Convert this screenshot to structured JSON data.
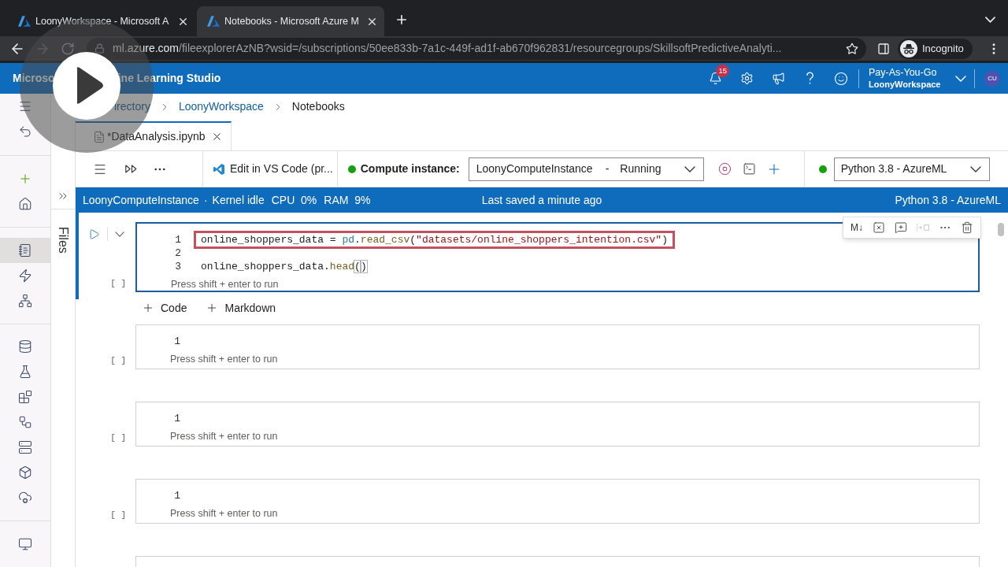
{
  "browser": {
    "tabs": [
      {
        "title": "LoonyWorkspace - Microsoft A",
        "selected": false
      },
      {
        "title": "Notebooks - Microsoft Azure M",
        "selected": true
      }
    ],
    "back": {
      "disabled": false
    },
    "forward": {
      "disabled": true
    },
    "address": {
      "host": "ml.azure.com",
      "path": "/fileexplorerAzNB?wsid=/subscriptions/50ee833b-7a1c-449f-ad1f-ab670f962831/resourcegroups/SkillsoftPredictiveAnalyti..."
    },
    "profile": "Incognito"
  },
  "studio_header": {
    "title_start": "Microso",
    "title_end": "ine Learning Studio",
    "notification_count": "15",
    "subscription": "Pay-As-You-Go",
    "workspace": "LoonyWorkspace",
    "avatar_initials": "CU"
  },
  "nav": {
    "groups": [
      {
        "items": [
          {
            "selected": false
          },
          {
            "selected": false
          }
        ]
      },
      {
        "items": [
          {
            "selected": false
          },
          {
            "selected": false
          }
        ]
      },
      {
        "items": [
          {
            "selected": true
          },
          {
            "selected": false
          },
          {
            "selected": false
          }
        ]
      },
      {
        "items": [
          {
            "selected": false
          },
          {
            "selected": false
          },
          {
            "selected": false
          },
          {
            "selected": false
          },
          {
            "selected": false
          },
          {
            "selected": false
          },
          {
            "selected": false
          }
        ]
      },
      {
        "items": [
          {
            "selected": false
          }
        ]
      }
    ]
  },
  "breadcrumb": [
    {
      "label": "irectory",
      "current": false
    },
    {
      "label": "LoonyWorkspace",
      "current": false
    },
    {
      "label": "Notebooks",
      "current": true
    }
  ],
  "files_panel": {
    "label": "Files"
  },
  "file_tabs": [
    {
      "title": "*DataAnalysis.ipynb",
      "selected": true
    }
  ],
  "toolbar": {
    "vscode": "Edit in VS Code (pr...",
    "compute_label": "Compute instance:",
    "compute_running": true,
    "compute": {
      "name": "LoonyComputeInstance",
      "separator": "-",
      "state": "Running"
    },
    "kernel_connected": true,
    "kernel": "Python 3.8 - AzureML"
  },
  "status_bar": {
    "compute": "LoonyComputeInstance",
    "separator": "·",
    "kernel_state": "Kernel idle",
    "metrics": [
      {
        "label": "CPU",
        "value": "0%"
      },
      {
        "label": "RAM",
        "value": "9%"
      }
    ],
    "saved": "Last saved a minute ago",
    "kernel": "Python 3.8 - AzureML"
  },
  "cell_toolbar": {
    "markdown": "M↓",
    "actions": [
      {
        "disabled": false
      },
      {
        "disabled": false
      },
      {
        "disabled": true
      },
      {
        "disabled": false
      },
      {
        "disabled": false
      }
    ]
  },
  "cells": [
    {
      "selected": true,
      "prompt": "[ ]",
      "lines": [
        {
          "number": "1",
          "marked": true,
          "tokens": [
            {
              "kind": "name",
              "text": "online_shoppers_data = "
            },
            {
              "kind": "module",
              "text": "pd"
            },
            {
              "kind": "plain",
              "text": "."
            },
            {
              "kind": "function",
              "text": "read_csv"
            },
            {
              "kind": "plain",
              "text": "("
            },
            {
              "kind": "string",
              "text": "\"datasets/online_shoppers_intention.csv\""
            },
            {
              "kind": "plain",
              "text": ")"
            }
          ]
        },
        {
          "number": "2",
          "marked": false
        },
        {
          "number": "3",
          "marked": false,
          "tokens": [
            {
              "kind": "name",
              "text": "online_shoppers_data"
            },
            {
              "kind": "plain",
              "text": "."
            },
            {
              "kind": "function",
              "text": "head"
            },
            {
              "kind": "bracket",
              "text": "("
            },
            {
              "kind": "bracket",
              "text": ")"
            }
          ]
        }
      ],
      "hint": "Press shift + enter to run"
    },
    {
      "selected": false,
      "prompt": "[ ]",
      "lines": [
        {
          "number": "1",
          "marked": false
        }
      ],
      "hint": "Press shift + enter to run"
    },
    {
      "selected": false,
      "prompt": "[ ]",
      "lines": [
        {
          "number": "1",
          "marked": false
        }
      ],
      "hint": "Press shift + enter to run"
    },
    {
      "selected": false,
      "prompt": "[ ]",
      "lines": [
        {
          "number": "1",
          "marked": false
        }
      ],
      "hint": "Press shift + enter to run"
    },
    {
      "selected": false
    }
  ],
  "add_cell": [
    {
      "label": "Code"
    },
    {
      "label": "Markdown"
    }
  ]
}
